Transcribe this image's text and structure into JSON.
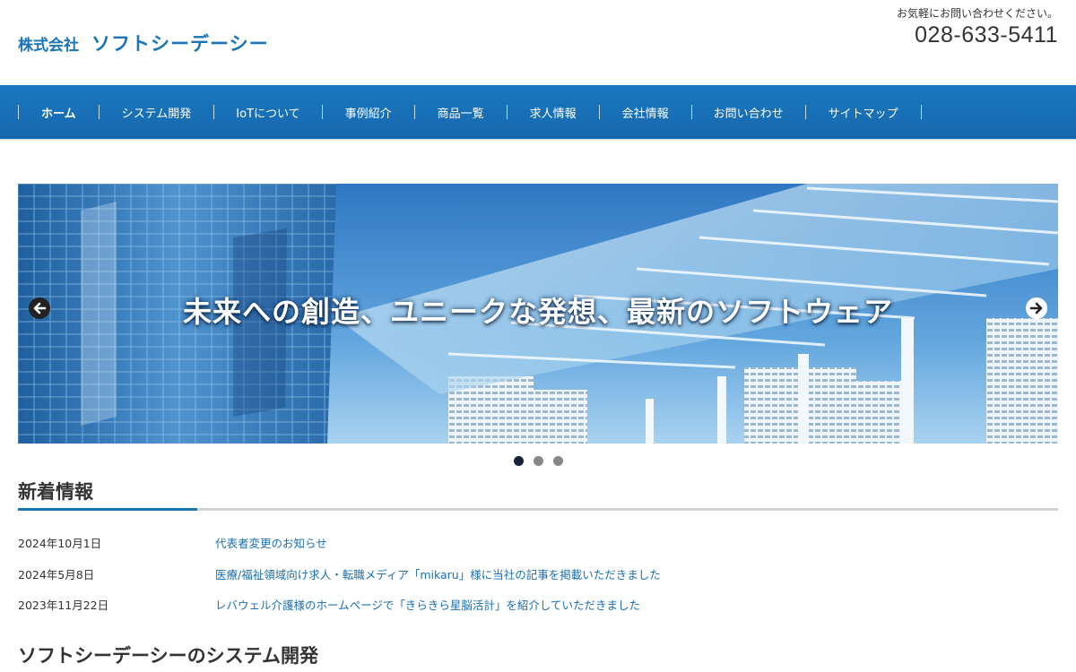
{
  "header": {
    "logo_kind": "株式会社",
    "logo_name": "ソフトシーデーシー",
    "contact_note": "お気軽にお問い合わせください。",
    "phone": "028-633-5411"
  },
  "nav": {
    "items": [
      {
        "label": "ホーム",
        "active": true
      },
      {
        "label": "システム開発"
      },
      {
        "label": "IoTについて"
      },
      {
        "label": "事例紹介"
      },
      {
        "label": "商品一覧"
      },
      {
        "label": "求人情報"
      },
      {
        "label": "会社情報"
      },
      {
        "label": "お問い合わせ"
      },
      {
        "label": "サイトマップ"
      }
    ]
  },
  "slider": {
    "caption": "未来への創造、ユニークな発想、最新のソフトウェア",
    "prev_icon": "arrow-left-icon",
    "next_icon": "arrow-right-icon",
    "slide_count": 3,
    "current_slide": 1
  },
  "news": {
    "title": "新着情報",
    "items": [
      {
        "date": "2024年10月1日",
        "text": "代表者変更のお知らせ"
      },
      {
        "date": "2024年5月8日",
        "text": "医療/福祉領域向け求人・転職メディア「mikaru」様に当社の記事を掲載いただきました"
      },
      {
        "date": "2023年11月22日",
        "text": "レバウェル介護様のホームページで「きらきら星脳活計」を紹介していただきました"
      }
    ]
  },
  "development": {
    "title": "ソフトシーデーシーのシステム開発"
  },
  "colors": {
    "brand": "#1a74b8",
    "nav_bg": "#1b78c0",
    "link": "#1a6fb0",
    "dot_active": "#17213a"
  }
}
